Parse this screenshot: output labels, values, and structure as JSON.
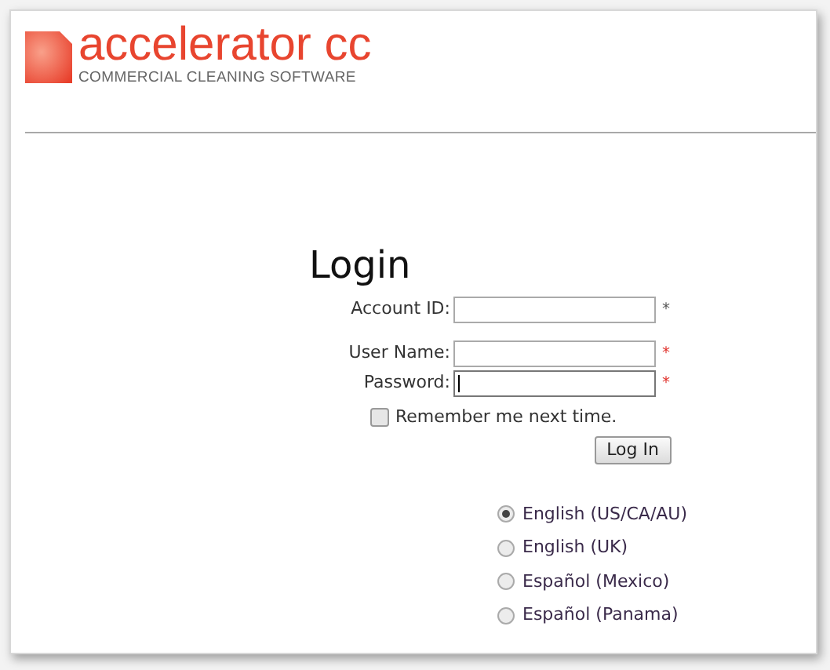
{
  "logo": {
    "name": "accelerator cc",
    "tagline": "COMMERCIAL CLEANING SOFTWARE"
  },
  "login": {
    "title": "Login",
    "fields": [
      {
        "label": "Account ID:",
        "focused": false,
        "asterisk": "*",
        "color": "#555555"
      },
      {
        "label": "User Name:",
        "focused": false,
        "asterisk": "*",
        "color": "#e0302a"
      },
      {
        "label": "Password:",
        "focused": true,
        "asterisk": "*",
        "color": "#e0302a"
      }
    ],
    "remember": {
      "label": "Remember me next time.",
      "checked": false
    },
    "button": "Log In"
  },
  "languages": [
    {
      "label": "English (US/CA/AU)",
      "selected": true
    },
    {
      "label": "English (UK)",
      "selected": false
    },
    {
      "label": "Español (Mexico)",
      "selected": false
    },
    {
      "label": "Español (Panama)",
      "selected": false
    }
  ]
}
